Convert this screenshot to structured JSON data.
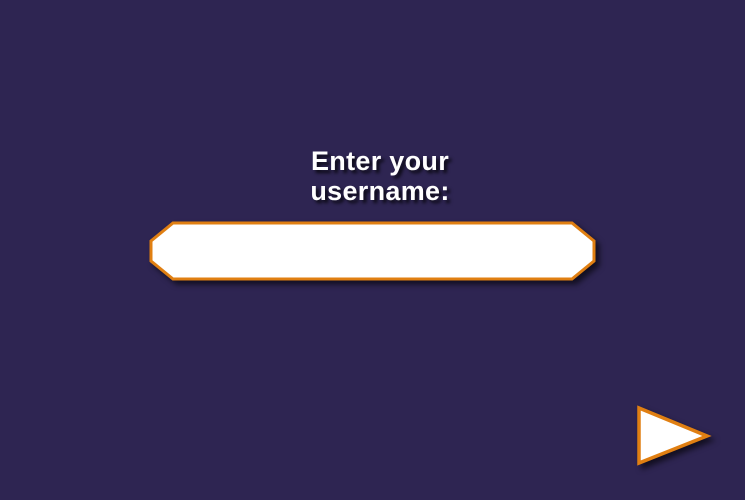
{
  "prompt": {
    "line1": "Enter your",
    "line2": "username:"
  },
  "username_field": {
    "value": "",
    "placeholder": ""
  },
  "next_button": {
    "icon": "play-arrow-icon"
  },
  "colors": {
    "background": "#2e2552",
    "accent_border": "#e07f12",
    "field_fill": "#ffffff",
    "text": "#ffffff"
  }
}
